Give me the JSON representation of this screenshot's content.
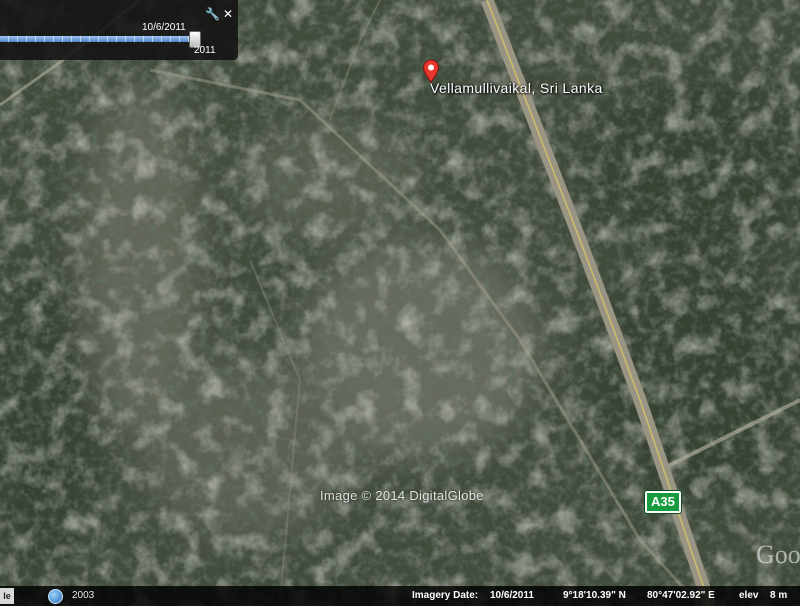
{
  "time_slider": {
    "date_top": "10/6/2011",
    "date_bottom": "2011",
    "settings_icon": "wrench-icon",
    "close_icon": "close-icon"
  },
  "placemark": {
    "label": "Vellamullivaikal, Sri Lanka",
    "icon": "map-pin-icon",
    "color": "#e8362f"
  },
  "road_shield": {
    "label": "A35",
    "color": "#169c3f"
  },
  "imagery_credit": "Image © 2014 DigitalGlobe",
  "watermark": "Goo",
  "status_bar": {
    "left_edge_text": "le",
    "globe_icon": "globe-icon",
    "historical_year": "2003",
    "imagery_date_label": "Imagery Date:",
    "imagery_date_value": "10/6/2011",
    "latitude": "9°18'10.39\" N",
    "longitude": "80°47'02.92\" E",
    "elev_label": "elev",
    "elev_value": "8 m"
  }
}
